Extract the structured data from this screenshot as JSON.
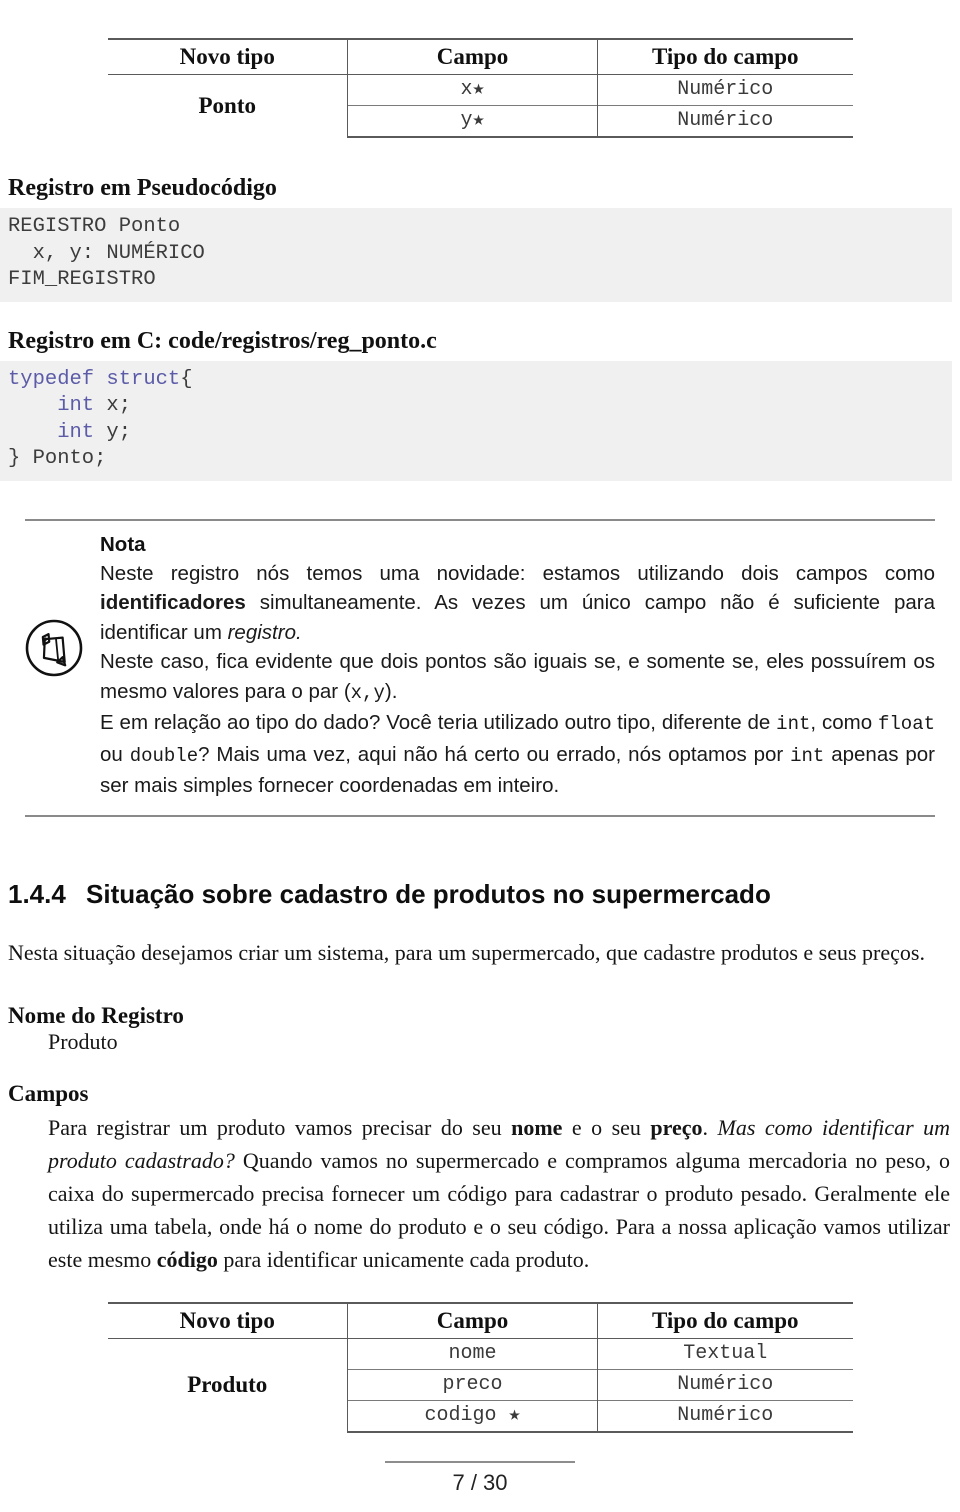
{
  "table_ponto": {
    "headers": [
      "Novo tipo",
      "Campo",
      "Tipo do campo"
    ],
    "type_name": "Ponto",
    "rows": [
      {
        "campo": "x★",
        "tipo": "Numérico"
      },
      {
        "campo": "y★",
        "tipo": "Numérico"
      }
    ]
  },
  "pseudocode": {
    "heading": "Registro em Pseudocódigo",
    "code": "REGISTRO Ponto\n  x, y: NUMÉRICO\nFIM_REGISTRO"
  },
  "c_code": {
    "heading": "Registro em C: code/registros/reg_ponto.c",
    "lines": [
      {
        "kw": "typedef struct",
        "rest": "{"
      },
      {
        "kw": "    int",
        "rest": " x;"
      },
      {
        "kw": "    int",
        "rest": " y;"
      },
      {
        "kw": "",
        "rest": "} Ponto;"
      }
    ]
  },
  "note": {
    "icon": "pencil-in-circle-icon",
    "title": "Nota",
    "p1_a": "Neste registro nós temos uma novidade: estamos utilizando dois campos como ",
    "p1_bold": "identificadores",
    "p1_b": " simultaneamente. As vezes um único campo não é suficiente para identificar um ",
    "p1_italic": "registro.",
    "p2_a": "Neste caso, fica evidente que dois pontos são iguais se, e somente se, eles possuírem os mesmo valores para o par (",
    "p2_mono1": "x,y",
    "p2_b": ").",
    "p3_a": "E em relação ao tipo do dado? Você teria utilizado outro tipo, diferente de ",
    "p3_mono1": "int",
    "p3_b": ", como ",
    "p3_mono2": "float",
    "p3_c": " ou ",
    "p3_mono3": "double",
    "p3_d": "? Mais uma vez, aqui não há certo ou errado, nós optamos por ",
    "p3_mono4": "int",
    "p3_e": " apenas por ser mais simples fornecer coordenadas em inteiro."
  },
  "section": {
    "number": "1.4.4",
    "title": "Situação sobre cadastro de produtos no supermercado",
    "intro": "Nesta situação desejamos criar um sistema, para um supermercado, que cadastre produtos e seus preços."
  },
  "registro": {
    "label": "Nome do Registro",
    "value": "Produto"
  },
  "campos": {
    "label": "Campos",
    "p_a": "Para registrar um produto vamos precisar do seu ",
    "p_bold1": "nome",
    "p_b": " e o seu ",
    "p_bold2": "preço",
    "p_c": ". ",
    "p_italic": "Mas como identificar um produto cadastrado?",
    "p_d": " Quando vamos no supermercado e compramos alguma mercadoria no peso, o caixa do supermercado precisa fornecer um código para cadastrar o produto pesado. Geralmente ele utiliza uma tabela, onde há o nome do produto e o seu código. Para a nossa aplicação vamos utilizar este mesmo ",
    "p_bold3": "código",
    "p_e": " para identificar unicamente cada produto."
  },
  "table_produto": {
    "headers": [
      "Novo tipo",
      "Campo",
      "Tipo do campo"
    ],
    "type_name": "Produto",
    "rows": [
      {
        "campo": "nome",
        "tipo": "Textual"
      },
      {
        "campo": "preco",
        "tipo": "Numérico"
      },
      {
        "campo": "codigo ★",
        "tipo": "Numérico"
      }
    ]
  },
  "footer": {
    "page_label": "7 / 30"
  }
}
